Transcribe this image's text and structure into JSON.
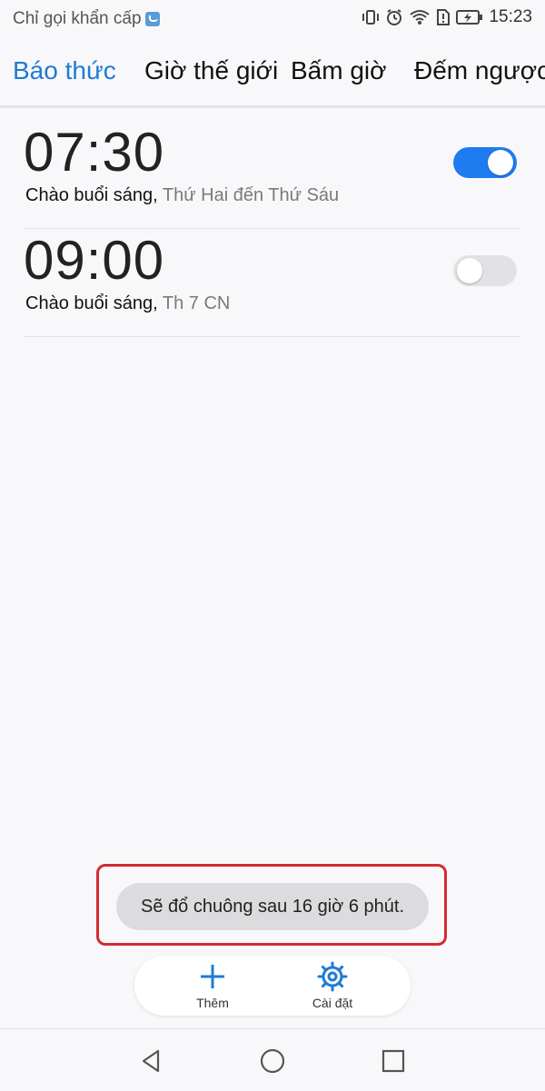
{
  "status_bar": {
    "carrier_text": "Chỉ gọi khẩn cấp",
    "time": "15:23"
  },
  "tabs": [
    {
      "label": "Báo thức",
      "active": true
    },
    {
      "label": "Giờ thế giới",
      "active": false
    },
    {
      "label": "Bấm giờ",
      "active": false
    },
    {
      "label": "Đếm ngược",
      "active": false
    }
  ],
  "alarms": [
    {
      "time": "07:30",
      "label": "Chào buổi sáng,",
      "repeat": "Thứ Hai đến Thứ Sáu",
      "enabled": true
    },
    {
      "time": "09:00",
      "label": "Chào buổi sáng,",
      "repeat": "Th 7 CN",
      "enabled": false
    }
  ],
  "toast": {
    "text": "Sẽ đổ chuông sau 16 giờ 6 phút."
  },
  "actions": {
    "add_label": "Thêm",
    "settings_label": "Cài đặt"
  },
  "colors": {
    "accent": "#1e7bd6",
    "toggle_on": "#1e7bf0",
    "highlight": "#d42a33"
  }
}
